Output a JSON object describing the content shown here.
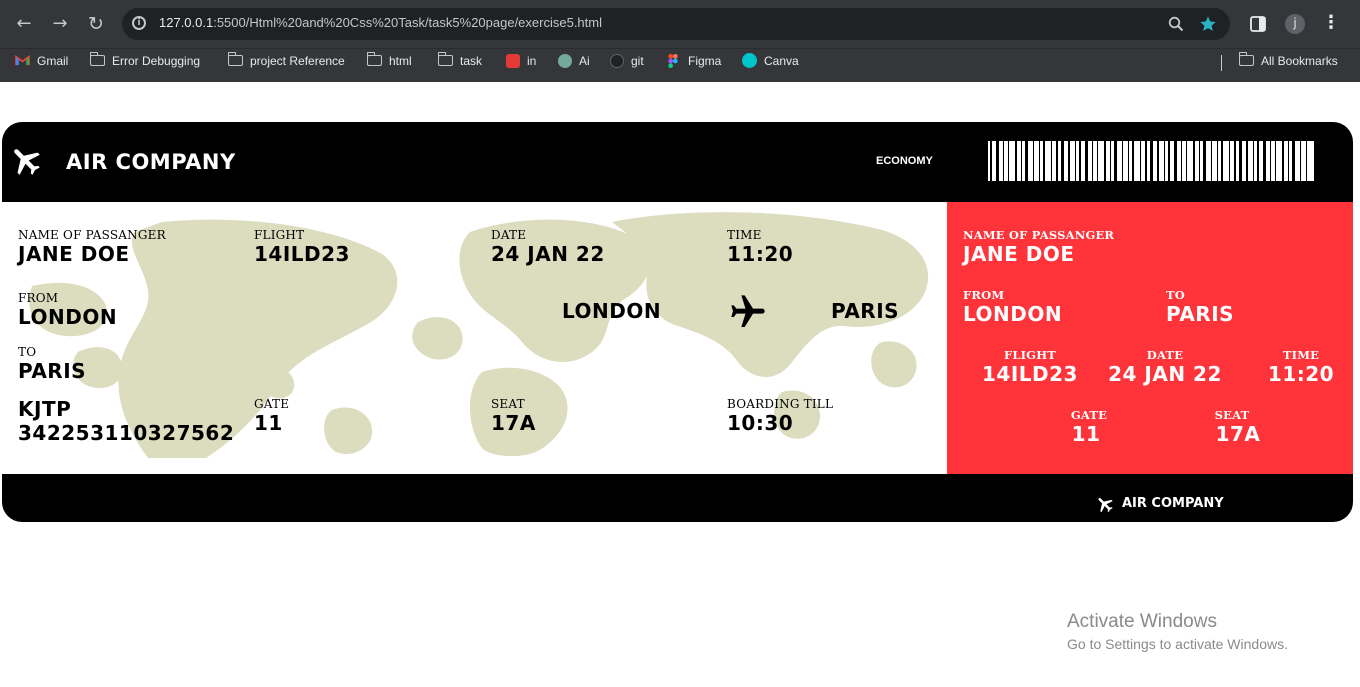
{
  "browser": {
    "url_host": "127.0.0.1",
    "url_path": ":5500/Html%20and%20Css%20Task/task5%20page/exercise5.html",
    "profile_initial": "j",
    "bookmarks": [
      {
        "label": "Gmail",
        "icon": "gmail-icon",
        "color": "#ea4335"
      },
      {
        "label": "Error Debugging",
        "icon": "folder-icon"
      },
      {
        "label": "project Reference",
        "icon": "folder-icon"
      },
      {
        "label": "html",
        "icon": "folder-icon"
      },
      {
        "label": "task",
        "icon": "folder-icon"
      },
      {
        "label": "in",
        "icon": "calendar-icon",
        "color": "#e53935"
      },
      {
        "label": "Ai",
        "icon": "chatgpt-icon",
        "color": "#74aa9c"
      },
      {
        "label": "git",
        "icon": "github-icon",
        "color": "#24292e"
      },
      {
        "label": "Figma",
        "icon": "figma-icon",
        "color": "#f24e1e"
      },
      {
        "label": "Canva",
        "icon": "canva-icon",
        "color": "#00c4cc"
      }
    ],
    "all_bookmarks": "All Bookmarks"
  },
  "ticket": {
    "company": "AIR COMPANY",
    "class": "ECONOMY",
    "passenger_label": "NAME OF PASSANGER",
    "passenger": "JANE DOE",
    "flight_label": "FLIGHT",
    "flight": "14ILD23",
    "date_label": "DATE",
    "date": "24 JAN 22",
    "time_label": "TIME",
    "time": "11:20",
    "from_label": "FROM",
    "from": "LONDON",
    "to_label": "TO",
    "to": "PARIS",
    "code": "KJTP",
    "number": "342253110327562",
    "gate_label": "GATE",
    "gate": "11",
    "seat_label": "SEAT",
    "seat": "17A",
    "boarding_label": "BOARDING TILL",
    "boarding": "10:30",
    "route_from": "LONDON",
    "route_to": "PARIS"
  },
  "colors": {
    "ticket_black": "#000000",
    "stub_red": "#ff343b",
    "map_beige": "#dcdcbf",
    "chrome": "#35363a"
  },
  "os_notice": {
    "title": "Activate Windows",
    "subtitle": "Go to Settings to activate Windows."
  }
}
